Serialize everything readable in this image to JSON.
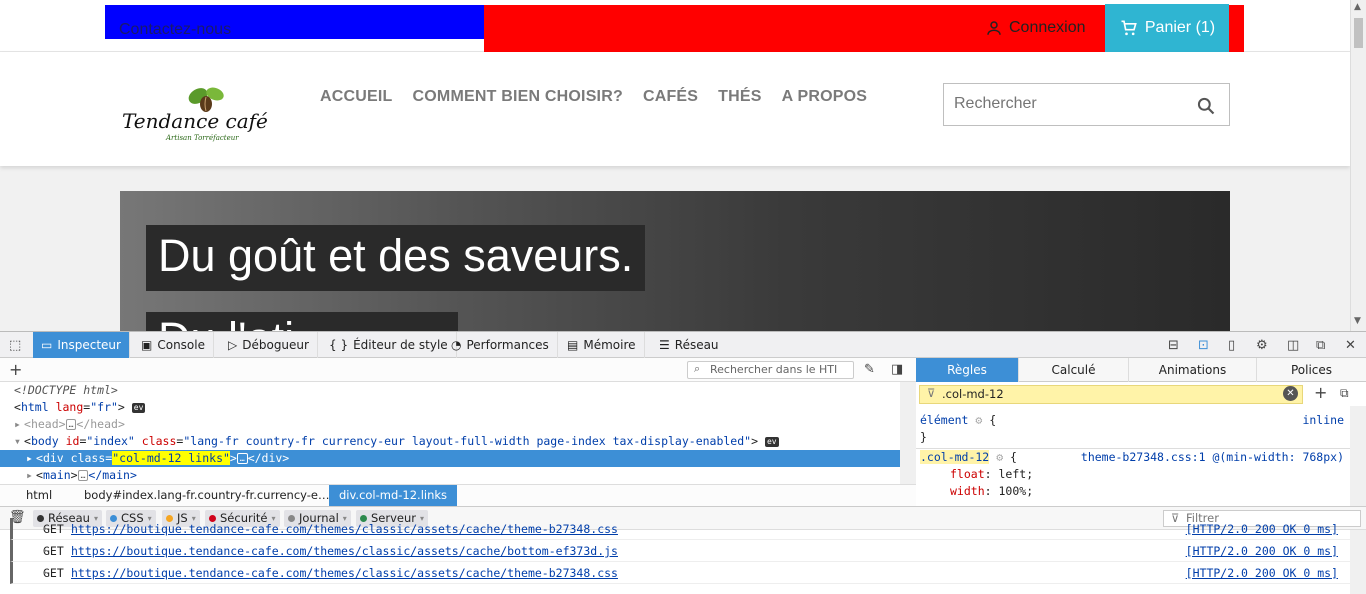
{
  "site": {
    "top": {
      "contact": "Contactez-nous",
      "login": "Connexion",
      "cart": "Panier (1)"
    },
    "nav": [
      "ACCUEIL",
      "COMMENT BIEN CHOISIR?",
      "CAFÉS",
      "THÉS",
      "A PROPOS"
    ],
    "search_placeholder": "Rechercher",
    "logo_text": "Tendance café",
    "logo_sub": "Artisan Torréfacteur",
    "hero_line1": "Du goût et des saveurs.",
    "hero_line2": "Du l'ati"
  },
  "devtools": {
    "tabs": [
      "Inspecteur",
      "Console",
      "Débogueur",
      "Éditeur de style",
      "Performances",
      "Mémoire",
      "Réseau"
    ],
    "html_search_placeholder": "Rechercher dans le HTI",
    "tree": {
      "doctype": "<!DOCTYPE html>",
      "html": {
        "tag": "html",
        "attr": "lang",
        "val": "\"fr\""
      },
      "head": {
        "tag": "head",
        "end": "</head>"
      },
      "body": {
        "tag": "body",
        "a1": "id",
        "v1": "\"index\"",
        "a2": "class",
        "v2": "\"lang-fr country-fr currency-eur layout-full-width page-index tax-display-enabled\""
      },
      "div": {
        "tag": "div",
        "attr": "class",
        "val": "\"col-md-12 links\"",
        "end": "</div>"
      },
      "main": {
        "tag": "main",
        "end": "</main>"
      }
    },
    "breadcrumb": [
      "html",
      "body#index.lang-fr.country-fr.currency-e…",
      "div.col-md-12.links"
    ],
    "rule_tabs": [
      "Règles",
      "Calculé",
      "Animations",
      "Polices"
    ],
    "rule_filter": ".col-md-12",
    "rules": {
      "element": "élément",
      "inline": "inline",
      "selector": ".col-md-12",
      "source": "theme-b27348.css:1 @(min-width: 768px)",
      "prop1": "float",
      "val1": "left",
      "prop2": "width",
      "val2": "100%"
    },
    "console_filters": [
      "Réseau",
      "CSS",
      "JS",
      "Sécurité",
      "Journal",
      "Serveur"
    ],
    "console_filter_colors": [
      "#333333",
      "#3d8fd6",
      "#f5a623",
      "#d0021b",
      "#888888",
      "#2d8a4e"
    ],
    "console_filter_placeholder": "Filtrer",
    "logs": [
      {
        "method": "GET",
        "url": "https://boutique.tendance-cafe.com/themes/classic/assets/cache/theme-b27348.css",
        "status": "[HTTP/2.0 200 OK 0 ms]"
      },
      {
        "method": "GET",
        "url": "https://boutique.tendance-cafe.com/themes/classic/assets/cache/bottom-ef373d.js",
        "status": "[HTTP/2.0 200 OK 0 ms]"
      },
      {
        "method": "GET",
        "url": "https://boutique.tendance-cafe.com/themes/classic/assets/cache/theme-b27348.css",
        "status": "[HTTP/2.0 200 OK 0 ms]"
      }
    ]
  }
}
